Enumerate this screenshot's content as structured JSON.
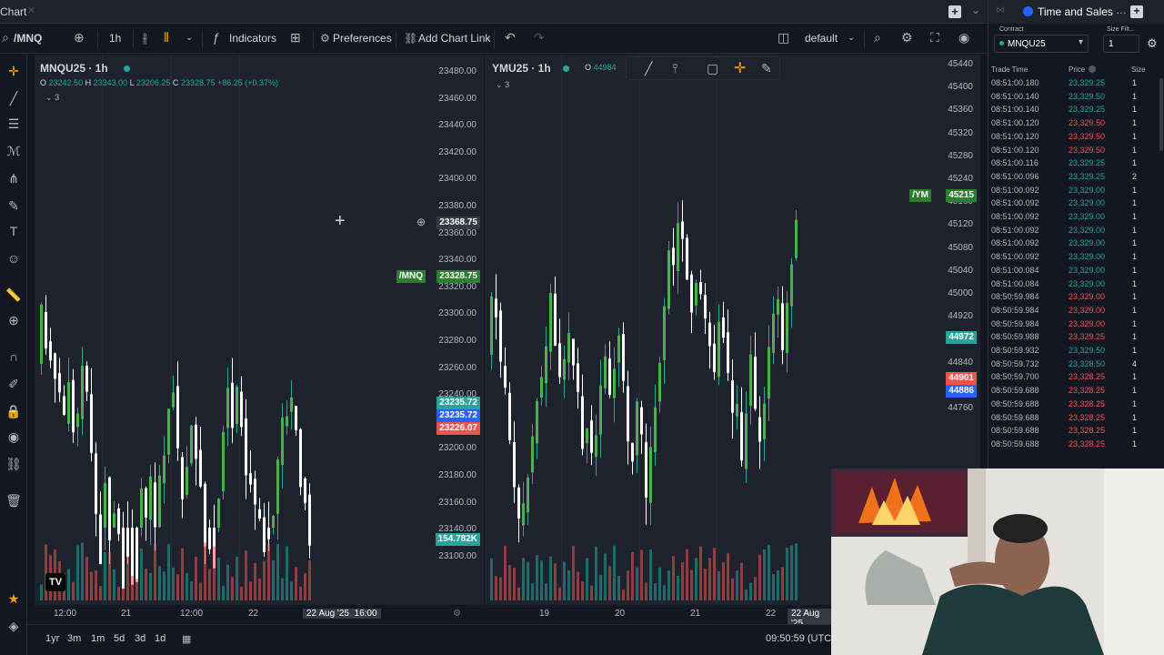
{
  "window": {
    "title": "Chart",
    "close": "✕",
    "add": "+",
    "menu": "⌄"
  },
  "toolbar": {
    "symbol": "/MNQ",
    "interval": "1h",
    "indicators": "Indicators",
    "preferences": "Preferences",
    "add_chart_link": "Add Chart Link",
    "layout": "default"
  },
  "left_pane": {
    "symbol": "MNQU25 · 1h",
    "ohlc_o": "O",
    "ohlc_o_val": "23242.50",
    "ohlc_h": "H",
    "ohlc_h_val": "23343.00",
    "ohlc_l": "L",
    "ohlc_l_val": "23206.25",
    "ohlc_c": "C",
    "ohlc_c_val": "23328.75 +86.25 (+0.37%)",
    "indicator_count": "3",
    "y_ticks": [
      "23480.00",
      "23460.00",
      "23440.00",
      "23420.00",
      "23400.00",
      "23380.00",
      "23360.00",
      "23340.00",
      "23320.00",
      "23300.00",
      "23280.00",
      "23260.00",
      "23240.00",
      "23220.00",
      "23200.00",
      "23180.00",
      "23160.00",
      "23140.00",
      "23100.00"
    ],
    "crosshair_price": "23368.75",
    "last_label": "/MNQ",
    "last_price": "23328.75",
    "label_green": "23235.72",
    "label_blue": "23235.72",
    "label_red": "23226.07",
    "volume_label": "154.782K",
    "x_labels": [
      "12:00",
      "21",
      "12:00",
      "22",
      "22 Aug '25  16:00"
    ]
  },
  "right_pane": {
    "symbol": "YMU25 · 1h",
    "ohlc_o": "O",
    "ohlc_o_val": "44984",
    "indicator_count": "3",
    "y_ticks": [
      "45440",
      "45400",
      "45360",
      "45320",
      "45280",
      "45240",
      "45160",
      "45120",
      "45080",
      "45040",
      "45000",
      "44920",
      "44880",
      "44840",
      "44800",
      "44760"
    ],
    "last_label": "/YM",
    "last_price": "45215",
    "label_green": "44972",
    "label_red": "44901",
    "label_blue": "44886",
    "x_labels": [
      "19",
      "20",
      "21",
      "22",
      "22 Aug '25"
    ]
  },
  "bottom": {
    "timeframes": [
      "1yr",
      "3m",
      "1m",
      "5d",
      "3d",
      "1d"
    ],
    "clock": "09:50:59 (UTC"
  },
  "time_sales": {
    "title": "Time and Sales",
    "contract_label": "Contract",
    "contract": "MNQU25",
    "size_filter_label": "Size Filt...",
    "size_filter": "1",
    "col_time": "Trade Time",
    "col_price": "Price",
    "col_size": "Size",
    "rows": [
      {
        "time": "08:51:00.180",
        "price": "23,329.25",
        "size": "1",
        "color": "#26a69a"
      },
      {
        "time": "08:51:00.140",
        "price": "23,329.50",
        "size": "1",
        "color": "#26a69a"
      },
      {
        "time": "08:51:00.140",
        "price": "23,329.25",
        "size": "1",
        "color": "#26a69a"
      },
      {
        "time": "08:51:00.120",
        "price": "23,329.50",
        "size": "1",
        "color": "#ef5350"
      },
      {
        "time": "08:51:00.120",
        "price": "23,329.50",
        "size": "1",
        "color": "#ef5350"
      },
      {
        "time": "08:51:00.120",
        "price": "23,329.50",
        "size": "1",
        "color": "#ef5350"
      },
      {
        "time": "08:51:00.116",
        "price": "23,329.25",
        "size": "1",
        "color": "#26a69a"
      },
      {
        "time": "08:51:00.096",
        "price": "23,329.25",
        "size": "2",
        "color": "#26a69a"
      },
      {
        "time": "08:51:00.092",
        "price": "23,329.00",
        "size": "1",
        "color": "#26a69a"
      },
      {
        "time": "08:51:00.092",
        "price": "23,329.00",
        "size": "1",
        "color": "#26a69a"
      },
      {
        "time": "08:51:00.092",
        "price": "23,329.00",
        "size": "1",
        "color": "#26a69a"
      },
      {
        "time": "08:51:00.092",
        "price": "23,329.00",
        "size": "1",
        "color": "#26a69a"
      },
      {
        "time": "08:51:00.092",
        "price": "23,329.00",
        "size": "1",
        "color": "#26a69a"
      },
      {
        "time": "08:51:00.092",
        "price": "23,329.00",
        "size": "1",
        "color": "#26a69a"
      },
      {
        "time": "08:51:00.084",
        "price": "23,329.00",
        "size": "1",
        "color": "#26a69a"
      },
      {
        "time": "08:51:00.084",
        "price": "23,329.00",
        "size": "1",
        "color": "#26a69a"
      },
      {
        "time": "08:50:59.984",
        "price": "23,329.00",
        "size": "1",
        "color": "#ef5350"
      },
      {
        "time": "08:50:59.984",
        "price": "23,329.00",
        "size": "1",
        "color": "#ef5350"
      },
      {
        "time": "08:50:59.984",
        "price": "23,329.00",
        "size": "1",
        "color": "#ef5350"
      },
      {
        "time": "08:50:59.988",
        "price": "23,329.25",
        "size": "1",
        "color": "#ef5350"
      },
      {
        "time": "08:50:59.932",
        "price": "23,329.50",
        "size": "1",
        "color": "#26a69a"
      },
      {
        "time": "08:50:59.732",
        "price": "23,328.50",
        "size": "4",
        "color": "#26a69a"
      },
      {
        "time": "08:50:59.700",
        "price": "23,328.25",
        "size": "1",
        "color": "#ef5350"
      },
      {
        "time": "08:50:59.688",
        "price": "23,328.25",
        "size": "1",
        "color": "#ef5350"
      },
      {
        "time": "08:50:59.688",
        "price": "23,328.25",
        "size": "1",
        "color": "#ef5350"
      },
      {
        "time": "08:50:59.688",
        "price": "23,328.25",
        "size": "1",
        "color": "#ef5350"
      },
      {
        "time": "08:50:59.688",
        "price": "23,328.25",
        "size": "1",
        "color": "#ef5350"
      },
      {
        "time": "08:50:59.688",
        "price": "23,328.25",
        "size": "1",
        "color": "#ef5350"
      }
    ]
  },
  "colors": {
    "up": "#26a69a",
    "down": "#ef5350",
    "bg": "#1e222d",
    "accent": "#2962ff"
  }
}
